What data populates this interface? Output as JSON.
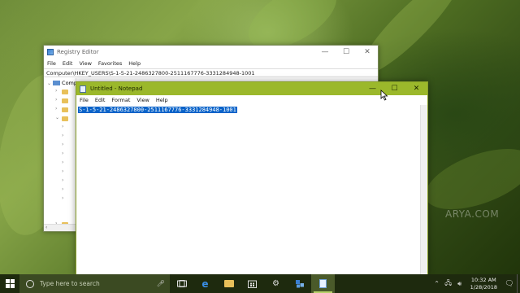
{
  "regedit": {
    "title": "Registry Editor",
    "menu": [
      "File",
      "Edit",
      "View",
      "Favorites",
      "Help"
    ],
    "address": "Computer\\HKEY_USERS\\S-1-5-21-2486327800-2511167776-3331284948-1001",
    "tree_root": "Comp",
    "controls": {
      "minimize": "—",
      "maximize": "☐",
      "close": "✕"
    }
  },
  "notepad": {
    "title": "Untitled - Notepad",
    "menu": [
      "File",
      "Edit",
      "Format",
      "View",
      "Help"
    ],
    "content": "S-1-5-21-2486327800-2511167776-3331284948-1001",
    "controls": {
      "minimize": "—",
      "maximize": "☐",
      "close": "✕"
    }
  },
  "taskbar": {
    "search_placeholder": "Type here to search",
    "time": "10:32 AM",
    "date": "1/28/2018",
    "tray_icons": [
      "chevron-up-icon",
      "network-icon",
      "volume-icon"
    ],
    "pinned_icons": [
      "cortana-mic-icon",
      "task-view-icon",
      "edge-icon",
      "file-explorer-icon",
      "store-icon",
      "settings-icon",
      "regedit-icon",
      "notepad-icon"
    ]
  },
  "watermark": "ARYA.COM",
  "accent_colors": {
    "notepad_titlebar": "#9bb82b",
    "selection": "#0a63c9",
    "taskbar": "#1e2a0e"
  }
}
